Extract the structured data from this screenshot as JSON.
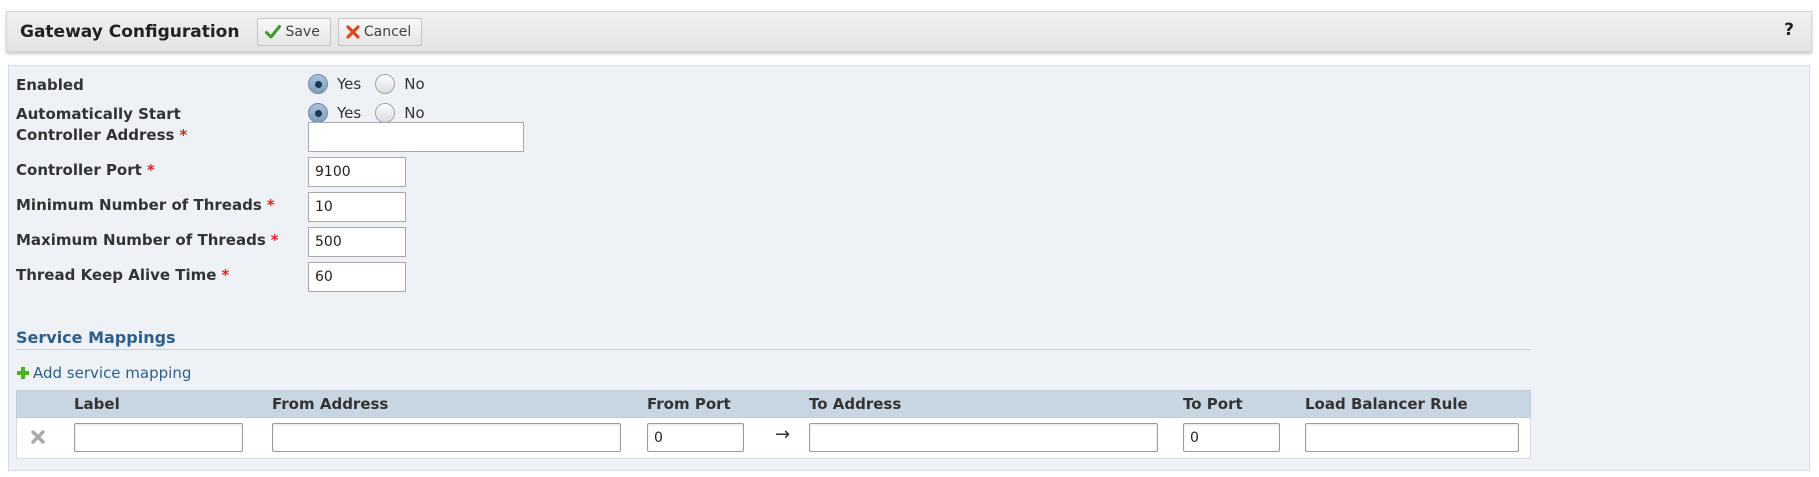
{
  "toolbar": {
    "title": "Gateway Configuration",
    "save_label": "Save",
    "cancel_label": "Cancel",
    "help_label": "?"
  },
  "form": {
    "enabled": {
      "label": "Enabled",
      "yes": "Yes",
      "no": "No",
      "selected": "Yes"
    },
    "auto_start": {
      "label": "Automatically Start",
      "yes": "Yes",
      "no": "No",
      "selected": "Yes"
    },
    "controller_address": {
      "label": "Controller Address",
      "required": "*",
      "value": ""
    },
    "controller_port": {
      "label": "Controller Port",
      "required": "*",
      "value": "9100"
    },
    "min_threads": {
      "label": "Minimum Number of Threads",
      "required": "*",
      "value": "10"
    },
    "max_threads": {
      "label": "Maximum Number of Threads",
      "required": "*",
      "value": "500"
    },
    "keep_alive": {
      "label": "Thread Keep Alive Time",
      "required": "*",
      "value": "60"
    }
  },
  "mappings": {
    "section_title": "Service Mappings",
    "add_label": "Add service mapping",
    "columns": {
      "label": "Label",
      "from_address": "From Address",
      "from_port": "From Port",
      "to_address": "To Address",
      "to_port": "To Port",
      "lb_rule": "Load Balancer Rule"
    },
    "rows": [
      {
        "label": "",
        "from_address": "",
        "from_port": "0",
        "arrow": "→",
        "to_address": "",
        "to_port": "0",
        "lb_rule": ""
      }
    ]
  },
  "icons": {
    "save": "checkmark-icon",
    "cancel": "x-icon",
    "add": "plus-icon",
    "delete": "delete-x-icon"
  },
  "colors": {
    "accent": "#2d5f8b",
    "required": "#dd2222",
    "panel_bg": "#eef2f7",
    "grid_header": "#c8d5e2",
    "save_check": "#3a9a2a",
    "cancel_x": "#d94a1e",
    "add_plus": "#4caf2a"
  }
}
